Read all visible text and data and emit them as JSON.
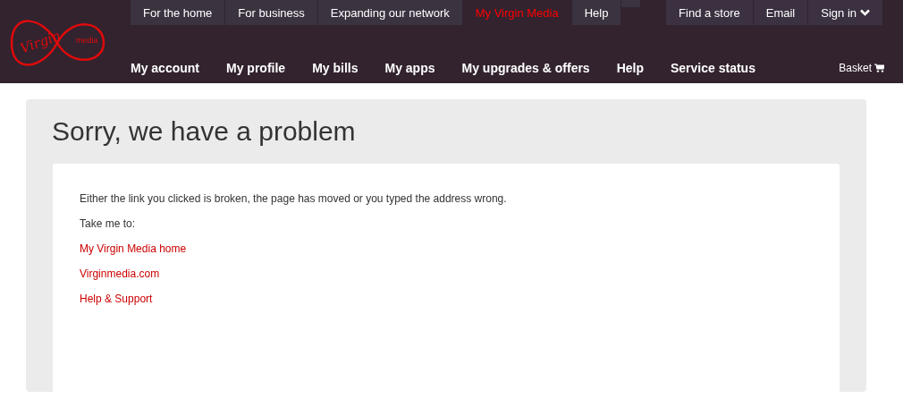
{
  "logo": {
    "word": "Virgin",
    "sub": "media"
  },
  "top_nav": [
    {
      "label": "For the home",
      "selected": false
    },
    {
      "label": "For business",
      "selected": false
    },
    {
      "label": "Expanding our network",
      "selected": false
    },
    {
      "label": "My Virgin Media",
      "selected": true
    },
    {
      "label": "Help",
      "selected": false
    }
  ],
  "utility_nav": [
    "Find a store",
    "Email",
    "Sign in"
  ],
  "main_nav": [
    "My account",
    "My profile",
    "My bills",
    "My apps",
    "My upgrades & offers",
    "Help",
    "Service status"
  ],
  "basket": "Basket",
  "page": {
    "title": "Sorry, we have a problem",
    "message": "Either the link you clicked is broken, the page has moved or you typed the address wrong.",
    "prompt": "Take me to:",
    "links": [
      "My Virgin Media home",
      "Virginmedia.com",
      "Help & Support"
    ]
  }
}
